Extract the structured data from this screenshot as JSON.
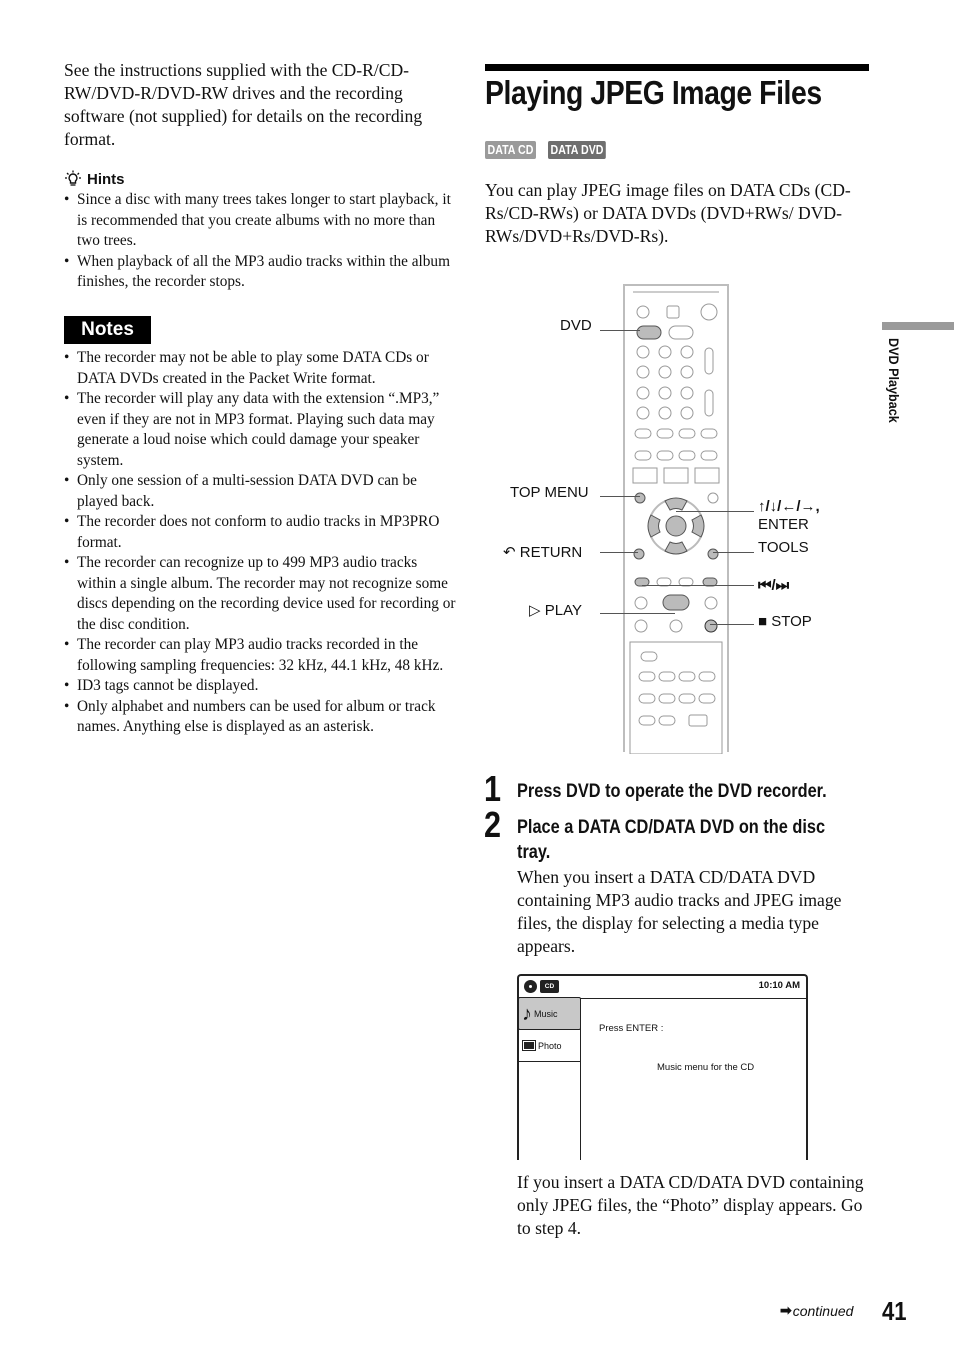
{
  "left": {
    "intro": "See the instructions supplied with the CD-R/CD-RW/DVD-R/DVD-RW drives and the recording software (not supplied) for details on the recording format.",
    "hints": {
      "icon": "lightbulb-icon",
      "title": "Hints",
      "items": [
        "Since a disc with many trees takes longer to start playback, it is recommended that you create albums with no more than two trees.",
        "When playback of all the MP3 audio tracks within the album finishes, the recorder stops."
      ]
    },
    "notes": {
      "title": "Notes",
      "items": [
        "The recorder may not be able to play some DATA CDs or DATA DVDs created in the Packet Write format.",
        "The recorder will play any data with the extension “.MP3,” even if they are not in MP3 format. Playing such data may generate a loud noise which could damage your speaker system.",
        "Only one session of a multi-session DATA DVD can be played back.",
        "The recorder does not conform to audio tracks in MP3PRO format.",
        "The recorder can recognize up to 499 MP3 audio tracks within a single album. The recorder may not recognize some discs depending on the recording device used for recording or the disc condition.",
        "The recorder can play MP3 audio tracks recorded in the following sampling frequencies: 32 kHz, 44.1 kHz, 48 kHz.",
        "ID3 tags cannot be displayed.",
        "Only alphabet and numbers can be used for album or track names. Anything else is displayed as an asterisk."
      ]
    }
  },
  "right": {
    "title": "Playing JPEG Image Files",
    "tags": [
      "DATA CD",
      "DATA DVD"
    ],
    "intro": "You can play JPEG image files on DATA CDs (CD-Rs/CD-RWs) or DATA DVDs (DVD+RWs/ DVD-RWs/DVD+Rs/DVD-Rs).",
    "remote_labels": {
      "dvd": "DVD",
      "top_menu": "TOP MENU",
      "return": "RETURN",
      "play": "PLAY",
      "arrows": "↑/↓/←/→,",
      "enter": "ENTER",
      "tools": "TOOLS",
      "skip": "⏮/⏭",
      "stop": "STOP"
    },
    "steps": [
      {
        "number": "1",
        "text": "Press DVD to operate the DVD recorder."
      },
      {
        "number": "2",
        "text": "Place a DATA CD/DATA DVD on the disc",
        "text2": "tray.",
        "body": "When you insert a DATA CD/DATA DVD containing MP3 audio tracks and JPEG image files, the display for selecting a media type appears."
      }
    ],
    "screen": {
      "disc_badge": "CD",
      "clock": "10:10 AM",
      "menu": [
        {
          "label": "Music",
          "icon": "music-note-icon",
          "selected": true
        },
        {
          "label": "Photo",
          "icon": "photo-icon",
          "selected": false
        }
      ],
      "prompt": "Press ENTER :",
      "description": "Music menu for the CD"
    },
    "photo_para": "If you insert a DATA CD/DATA DVD containing only JPEG files, the “Photo” display appears. Go to step 4."
  },
  "side_tab": "DVD Playback",
  "footer": {
    "continued": "continued",
    "page_number": "41"
  },
  "colors": {
    "tag_cd": "#9a9a9a",
    "tag_dvd": "#6e6e6e",
    "side_bar": "#9a9a9a",
    "screen_selected": "#c8c8c8"
  }
}
